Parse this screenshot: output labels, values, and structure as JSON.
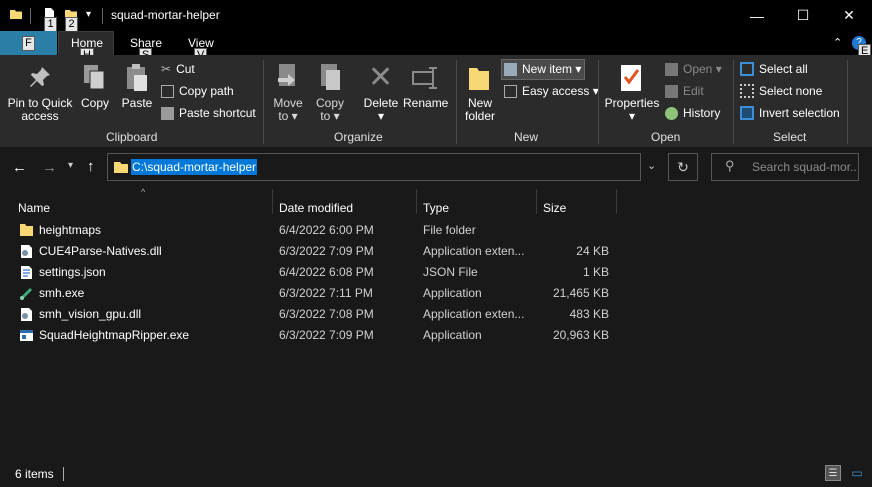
{
  "window": {
    "title": "squad-mortar-helper",
    "controls": {
      "minimize": "—",
      "maximize": "☐",
      "close": "✕"
    }
  },
  "quick_access": {
    "keytips": [
      "1",
      "2"
    ]
  },
  "ribbon_tabs": {
    "file_keytip": "F",
    "tabs": [
      {
        "label": "Home",
        "keytip": "H"
      },
      {
        "label": "Share",
        "keytip": "S"
      },
      {
        "label": "View",
        "keytip": "V"
      }
    ],
    "help_keytip": "E"
  },
  "ribbon": {
    "clipboard": {
      "group_label": "Clipboard",
      "pin": "Pin to Quick\naccess",
      "copy": "Copy",
      "paste": "Paste",
      "cut": "Cut",
      "copy_path": "Copy path",
      "paste_shortcut": "Paste shortcut"
    },
    "organize": {
      "group_label": "Organize",
      "move_to": "Move\nto ▾",
      "copy_to": "Copy\nto ▾",
      "delete": "Delete\n▾",
      "rename": "Rename"
    },
    "new": {
      "group_label": "New",
      "new_folder": "New\nfolder",
      "new_item": "New item ▾",
      "easy_access": "Easy access ▾"
    },
    "open": {
      "group_label": "Open",
      "properties": "Properties\n▾",
      "open": "Open ▾",
      "edit": "Edit",
      "history": "History"
    },
    "select": {
      "group_label": "Select",
      "select_all": "Select all",
      "select_none": "Select none",
      "invert_selection": "Invert selection"
    }
  },
  "address_bar": {
    "path": "C:\\squad-mortar-helper",
    "search_placeholder": "Search squad-mor..."
  },
  "columns": {
    "name": "Name",
    "date_modified": "Date modified",
    "type": "Type",
    "size": "Size"
  },
  "files": [
    {
      "name": "heightmaps",
      "date": "6/4/2022 6:00 PM",
      "type": "File folder",
      "size": "",
      "icon": "folder-icon"
    },
    {
      "name": "CUE4Parse-Natives.dll",
      "date": "6/3/2022 7:09 PM",
      "type": "Application exten...",
      "size": "24 KB",
      "icon": "dll-file-icon"
    },
    {
      "name": "settings.json",
      "date": "6/4/2022 6:08 PM",
      "type": "JSON File",
      "size": "1 KB",
      "icon": "json-file-icon"
    },
    {
      "name": "smh.exe",
      "date": "6/3/2022 7:11 PM",
      "type": "Application",
      "size": "21,465 KB",
      "icon": "mortar-exe-icon"
    },
    {
      "name": "smh_vision_gpu.dll",
      "date": "6/3/2022 7:08 PM",
      "type": "Application exten...",
      "size": "483 KB",
      "icon": "dll-file-icon"
    },
    {
      "name": "SquadHeightmapRipper.exe",
      "date": "6/3/2022 7:09 PM",
      "type": "Application",
      "size": "20,963 KB",
      "icon": "exe-window-icon"
    }
  ],
  "status_bar": {
    "item_count": "6 items"
  },
  "colors": {
    "file_tab": "#2a7fa9",
    "selection": "#0078d7",
    "folder": "#f8d775",
    "background": "#191919",
    "ribbon": "#2b2b2b"
  }
}
